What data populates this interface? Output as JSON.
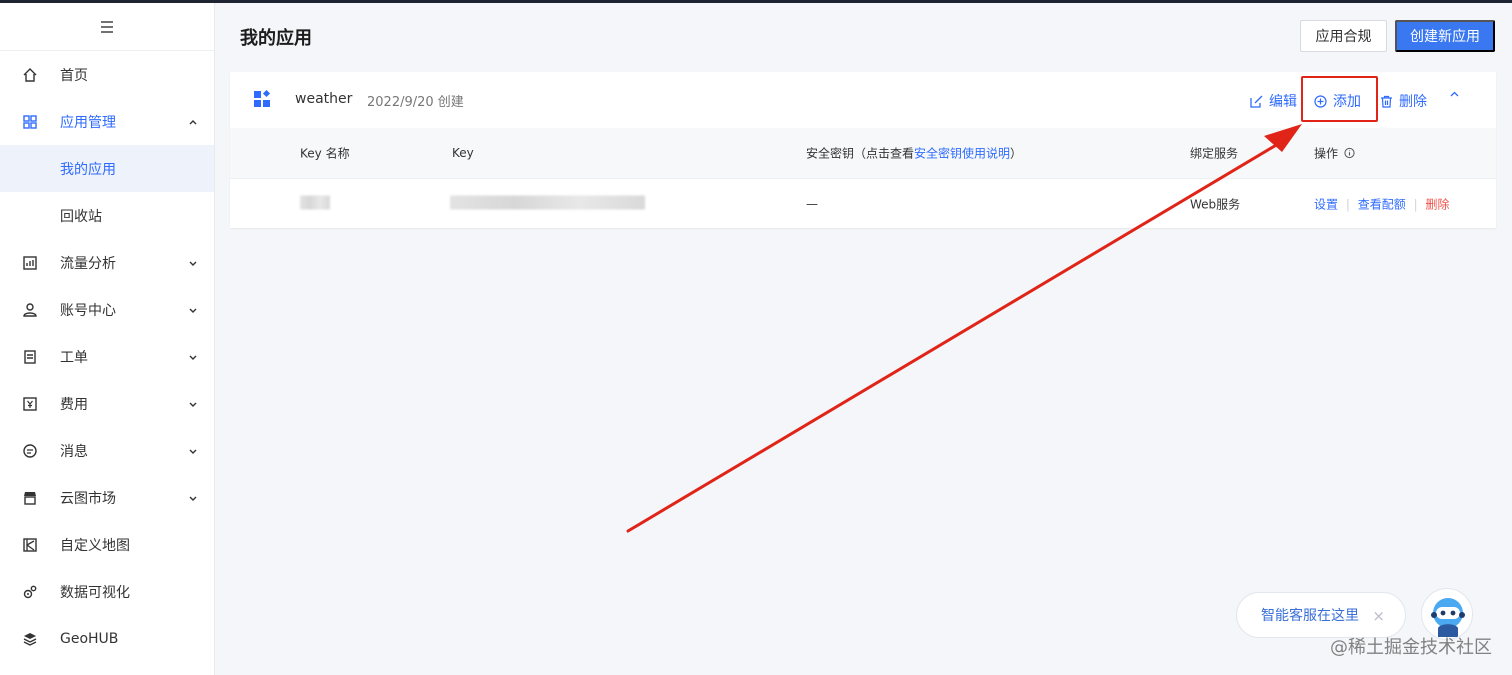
{
  "sidebar": {
    "toggle_icon": "menu-icon",
    "items": [
      {
        "label": "首页",
        "icon": "home-icon"
      },
      {
        "label": "应用管理",
        "icon": "grid-icon"
      },
      {
        "label": "流量分析",
        "icon": "chart-icon"
      },
      {
        "label": "账号中心",
        "icon": "user-icon"
      },
      {
        "label": "工单",
        "icon": "ticket-icon"
      },
      {
        "label": "费用",
        "icon": "yen-icon"
      },
      {
        "label": "消息",
        "icon": "message-icon"
      },
      {
        "label": "云图市场",
        "icon": "store-icon"
      },
      {
        "label": "自定义地图",
        "icon": "map-icon"
      },
      {
        "label": "数据可视化",
        "icon": "visual-icon"
      },
      {
        "label": "GeoHUB",
        "icon": "layers-icon"
      }
    ],
    "sub_items": [
      {
        "label": "我的应用"
      },
      {
        "label": "回收站"
      }
    ]
  },
  "header": {
    "title": "我的应用",
    "compliance_btn": "应用合规",
    "create_btn": "创建新应用"
  },
  "app": {
    "name": "weather",
    "created": "2022/9/20 创建",
    "edit": "编辑",
    "add": "添加",
    "delete": "删除"
  },
  "table": {
    "col_key_name": "Key 名称",
    "col_key": "Key",
    "col_secret_prefix": "安全密钥（点击查看",
    "col_secret_link": "安全密钥使用说明",
    "col_secret_suffix": "）",
    "col_service": "绑定服务",
    "col_ops": "操作",
    "rows": [
      {
        "secret": "—",
        "service": "Web服务",
        "op_settings": "设置",
        "op_quota": "查看配额",
        "op_delete": "删除"
      }
    ]
  },
  "chat": {
    "text": "智能客服在这里",
    "close": "×"
  },
  "watermark": "@稀土掘金技术社区",
  "colors": {
    "accent": "#2f6bff",
    "primary_btn": "#3a78f2",
    "danger": "#f0524a",
    "annotation_red": "#e02418"
  }
}
